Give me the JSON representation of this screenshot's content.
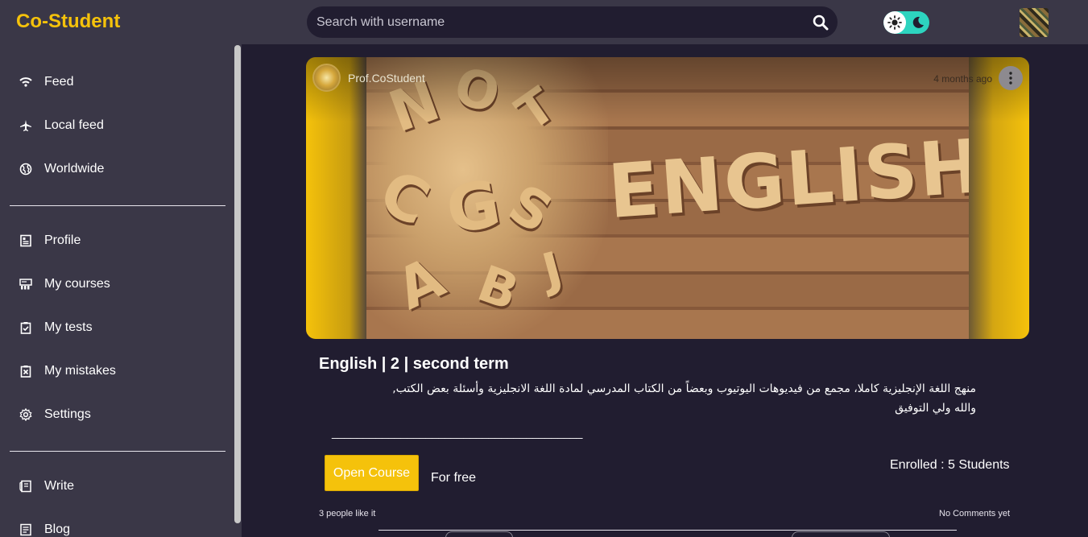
{
  "header": {
    "brand": "Co-Student",
    "search_placeholder": "Search with username",
    "colors": {
      "brand": "#f5c20b",
      "bar": "#3a3747",
      "bg": "#211d30",
      "toggle": "#2dd4bf"
    },
    "icons": [
      "search-icon",
      "sun-icon",
      "moon-icon",
      "avatar"
    ]
  },
  "sidebar": {
    "items": [
      {
        "label": "Feed",
        "icon": "wifi-icon"
      },
      {
        "label": "Local feed",
        "icon": "airplane-icon"
      },
      {
        "label": "Worldwide",
        "icon": "globe-icon"
      },
      {
        "label": "Profile",
        "icon": "profile-card-icon"
      },
      {
        "label": "My courses",
        "icon": "courses-icon"
      },
      {
        "label": "My tests",
        "icon": "clipboard-check-icon"
      },
      {
        "label": "My mistakes",
        "icon": "clipboard-x-icon"
      },
      {
        "label": "Settings",
        "icon": "gear-icon"
      },
      {
        "label": "Write",
        "icon": "write-icon"
      },
      {
        "label": "Blog",
        "icon": "blog-icon"
      }
    ]
  },
  "post": {
    "author": "Prof.CoStudent",
    "time": "4 months ago",
    "image_word": "ENGLISH",
    "title": "English | 2 | second term",
    "description_line1": "منهج اللغة الإنجليزية كاملا، مجمع من فيديوهات اليوتيوب وبعضاً من الكتاب المدرسي لمادة اللغة الانجليزية وأسئلة بعض الكتب,",
    "description_line2": "والله ولي التوفيق",
    "description_rule": "________________________________________",
    "open_button": "Open Course",
    "price": "For free",
    "enrolled": "Enrolled : 5 Students",
    "likes": "3 people like it",
    "comments": "No Comments yet"
  }
}
